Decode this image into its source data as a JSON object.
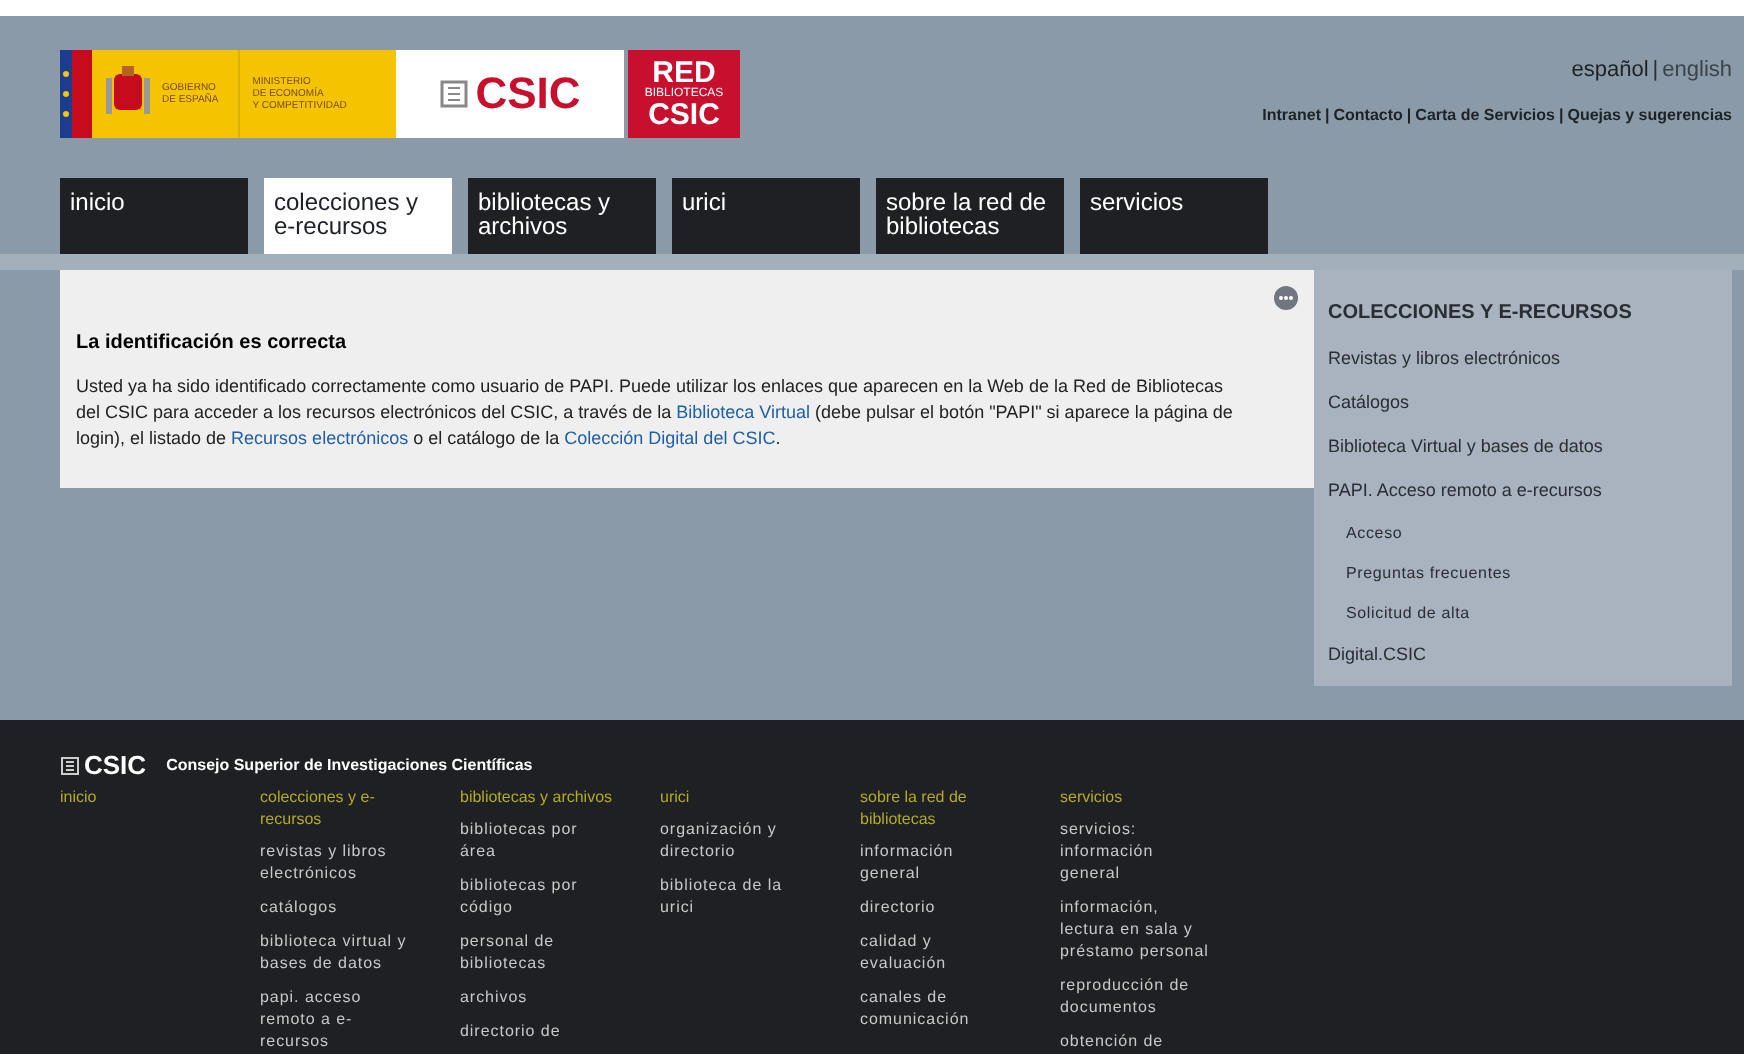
{
  "header": {
    "government_logo": {
      "line_1": "GOBIERNO",
      "line_2": "DE ESPAÑA",
      "ministry_1": "MINISTERIO",
      "ministry_2": "DE ECONOMÍA",
      "ministry_3": "Y COMPETITIVIDAD"
    },
    "csic_logo": "CSIC",
    "red_logo": {
      "line_1": "RED",
      "line_2": "BIBLIOTECAS",
      "line_3": "CSIC"
    },
    "languages": [
      {
        "label": "español",
        "selected": true
      },
      {
        "label": "english",
        "selected": false
      }
    ],
    "separator": "|",
    "top_links": [
      "Intranet",
      "Contacto",
      "Carta de Servicios",
      "Quejas y sugerencias"
    ]
  },
  "nav_tabs": [
    {
      "label": "inicio",
      "selected": false
    },
    {
      "label": "colecciones y e-recursos",
      "selected": true
    },
    {
      "label": "bibliotecas y archivos",
      "selected": false
    },
    {
      "label": "urici",
      "selected": false
    },
    {
      "label": "sobre la red de bibliotecas",
      "selected": false
    },
    {
      "label": "servicios",
      "selected": false
    }
  ],
  "message": {
    "title": "La identificación es correcta",
    "parts": [
      {
        "kind": "text",
        "text": "Usted ya ha sido identificado correctamente como usuario de PAPI. Puede utilizar los enlaces que aparecen en la Web de la Red de Bibliotecas del CSIC para acceder a los recursos electrónicos del CSIC, a través de la "
      },
      {
        "kind": "link",
        "text": "Biblioteca Virtual"
      },
      {
        "kind": "text",
        "text": " (debe pulsar el botón \"PAPI\" si aparece la página de login), el listado de "
      },
      {
        "kind": "link",
        "text": "Recursos electrónicos"
      },
      {
        "kind": "text",
        "text": " o el catálogo de la "
      },
      {
        "kind": "link",
        "text": "Colección Digital del CSIC"
      },
      {
        "kind": "text",
        "text": "."
      }
    ]
  },
  "sidebar": {
    "title": "COLECCIONES Y E-RECURSOS",
    "items": [
      {
        "label": "Revistas y libros electrónicos"
      },
      {
        "label": "Catálogos"
      },
      {
        "label": "Biblioteca Virtual y bases de datos"
      },
      {
        "label": "PAPI. Acceso remoto a e-recursos",
        "children": [
          {
            "label": "Acceso"
          },
          {
            "label": "Preguntas frecuentes"
          },
          {
            "label": "Solicitud de alta"
          }
        ]
      },
      {
        "label": "Digital.CSIC"
      }
    ]
  },
  "footer": {
    "logo": "CSIC",
    "title": "Consejo Superior de Investigaciones Científicas",
    "columns": [
      {
        "heading": "inicio"
      },
      {
        "heading": "colecciones y e-recursos",
        "items": [
          "revistas y libros electrónicos",
          "catálogos",
          "biblioteca virtual y bases de datos",
          "papi. acceso remoto a e-recursos"
        ]
      },
      {
        "heading": "bibliotecas y archivos",
        "items": [
          "bibliotecas por área",
          "bibliotecas por código",
          "personal de bibliotecas",
          "archivos",
          "directorio de"
        ]
      },
      {
        "heading": "urici",
        "items": [
          "organización y directorio",
          "biblioteca de la urici"
        ]
      },
      {
        "heading": "sobre la red de bibliotecas",
        "items": [
          "información general",
          "directorio",
          "calidad y evaluación",
          "canales de comunicación"
        ]
      },
      {
        "heading": "servicios",
        "items": [
          "servicios: información general",
          "información, lectura en sala y préstamo personal",
          "reproducción de documentos",
          "obtención de"
        ]
      }
    ]
  }
}
